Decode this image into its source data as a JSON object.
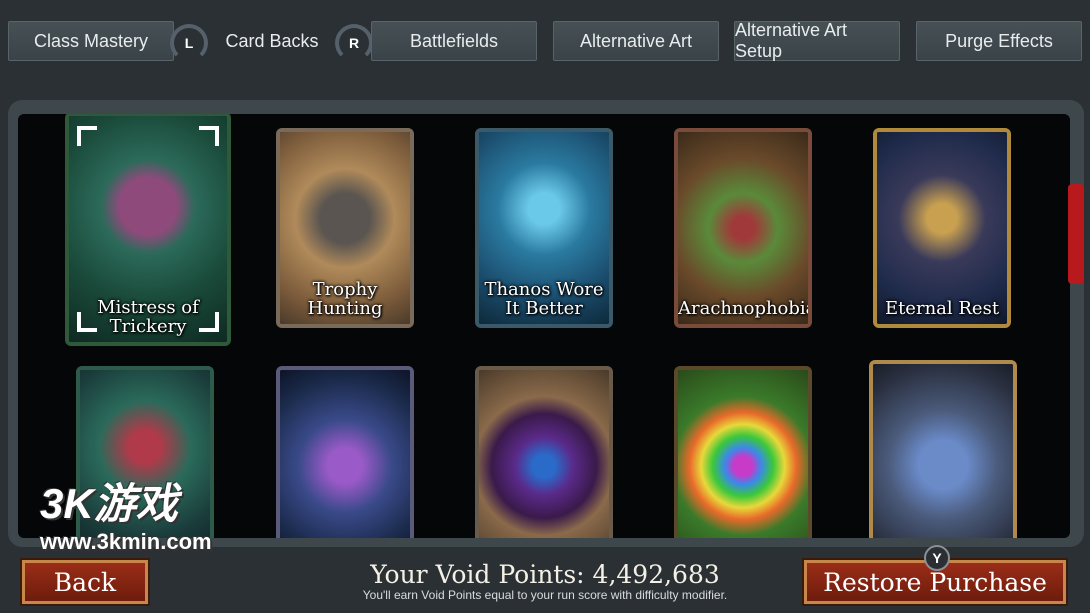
{
  "tabs": [
    {
      "label": "Class Mastery"
    },
    {
      "label": "Card Backs"
    },
    {
      "label": "Battlefields"
    },
    {
      "label": "Alternative Art"
    },
    {
      "label": "Alternative Art Setup"
    },
    {
      "label": "Purge Effects"
    }
  ],
  "shoulder_buttons": {
    "left": "L",
    "right": "R"
  },
  "cards": [
    {
      "label": "Mistress of\nTrickery",
      "selected": true
    },
    {
      "label": "Trophy\nHunting"
    },
    {
      "label": "Thanos Wore\nIt Better"
    },
    {
      "label": "Arachnophobia"
    },
    {
      "label": "Eternal Rest"
    },
    {
      "label": ""
    },
    {
      "label": ""
    },
    {
      "label": ""
    },
    {
      "label": ""
    },
    {
      "label": ""
    }
  ],
  "footer": {
    "back_label": "Back",
    "void_points_text": "Your Void Points: 4,492,683",
    "void_note": "You'll earn Void Points equal to your run score with difficulty modifier.",
    "restore_label": "Restore Purchase",
    "restore_hotkey": "Y"
  },
  "watermark": {
    "logo": "3K游戏",
    "url": "www.3kmin.com"
  },
  "colors": {
    "accent_red": "#b8191c",
    "button_border": "#c8874a"
  }
}
